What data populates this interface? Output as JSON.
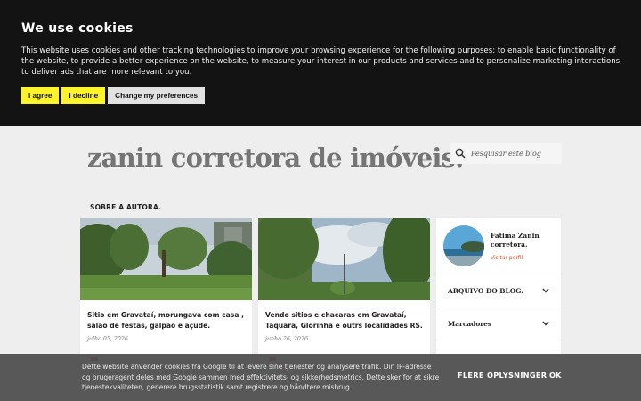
{
  "consent": {
    "title": "We use cookies",
    "body": "This website uses cookies and other tracking technologies to improve your browsing experience for the following purposes: to enable basic functionality of the website, to provide a better experience on the website, to measure your interest in our products and services and to personalize marketing interactions, to deliver ads that are more relevant to you.",
    "agree_label": "I agree",
    "decline_label": "I decline",
    "prefs_label": "Change my preferences",
    "button_color": "#fdf32a"
  },
  "blog": {
    "title": "zanin corretora de imóveis.",
    "search_placeholder": "Pesquisar este blog",
    "nav_about": "SOBRE A AUTORA."
  },
  "posts": [
    {
      "title": "Sitio em Gravataí, morungava com casa , salão de festas, galpão e açude.",
      "date": "julho 05, 2026"
    },
    {
      "title": "Vendo sitios e chacaras em Gravataí, Taquara, Glorinha e outrs localidades RS.",
      "date": "junho 26, 2026"
    }
  ],
  "sidebar": {
    "profile_name": "Fatima Zanin corretora.",
    "profile_link": "Visitar perfil",
    "archive_label": "ARQUIVO DO BLOG.",
    "labels_label": "Marcadores",
    "link_color": "#d5572e"
  },
  "google_bar": {
    "text": "Dette website anvender cookies fra Google til at levere sine tjenester og analysere trafik. Din IP-adresse og brugeragent deles med Google sammen med effektivitets- og sikkerhedsmetrics. Dette sker for at sikre tjenestekvaliteten, generere brugsstatistik samt registrere og håndtere misbrug.",
    "more_label": "FLERE OPLYSNINGER",
    "ok_label": "OK"
  }
}
